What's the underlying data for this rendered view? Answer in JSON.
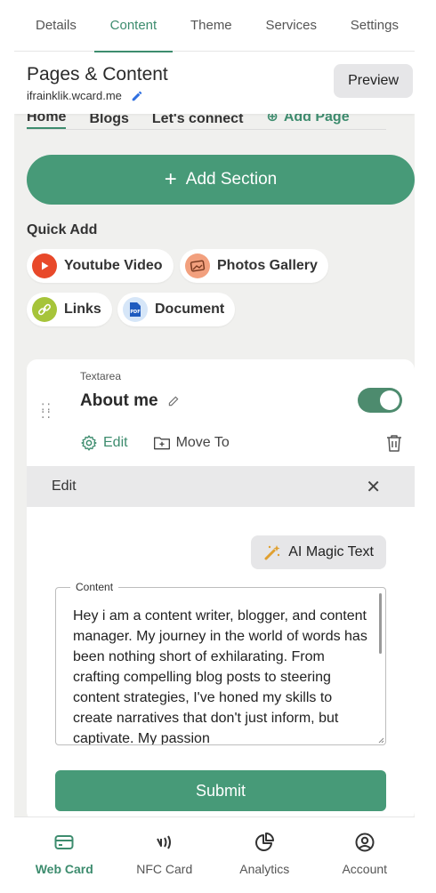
{
  "topnav": {
    "tabs": [
      "Details",
      "Content",
      "Theme",
      "Services",
      "Settings"
    ],
    "active": "Content"
  },
  "header": {
    "title": "Pages & Content",
    "domain": "ifrainklik.wcard.me",
    "preview_label": "Preview"
  },
  "page_tabs": [
    "Home",
    "Blogs",
    "Let's connect",
    "Add Page"
  ],
  "add_section_label": "Add Section",
  "quick_add": {
    "label": "Quick Add",
    "items": [
      "Youtube Video",
      "Photos Gallery",
      "Links",
      "Document"
    ]
  },
  "section_card": {
    "type": "Textarea",
    "name": "About me",
    "enabled": true,
    "edit_label": "Edit",
    "move_label": "Move To"
  },
  "edit_panel": {
    "title": "Edit",
    "magic_label": "AI Magic Text",
    "content_label": "Content",
    "content_value": "Hey i am a content writer, blogger, and content manager. My journey in the world of words has been nothing short of exhilarating. From crafting compelling blog posts to steering content strategies, I've honed my skills to create narratives that don't just inform, but captivate. My passion",
    "submit_label": "Submit"
  },
  "bottomnav": {
    "items": [
      "Web Card",
      "NFC Card",
      "Analytics",
      "Account"
    ],
    "active": "Web Card"
  },
  "colors": {
    "accent": "#479a78",
    "accent_dark": "#3d8c6e",
    "background": "#f0f0ee"
  }
}
